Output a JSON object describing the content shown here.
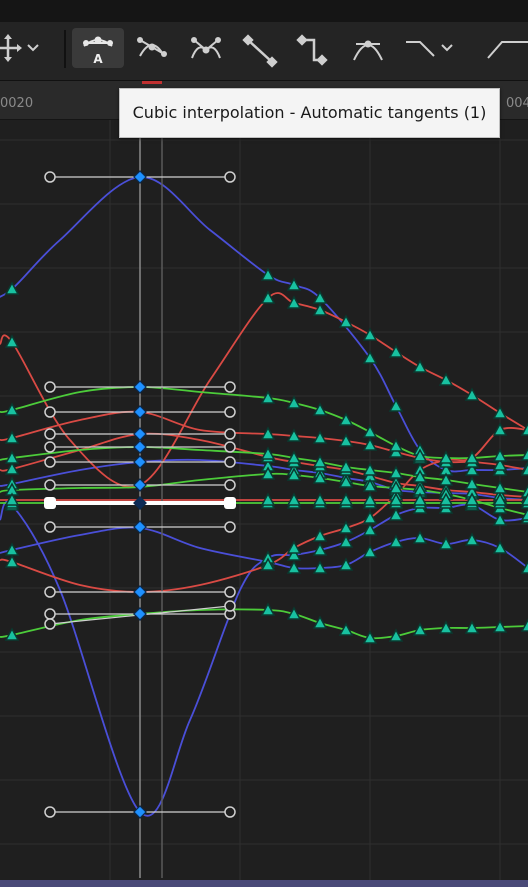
{
  "toolbar": {
    "buttons": [
      {
        "icon": "move-icon",
        "has_dropdown": true,
        "active": false
      },
      {
        "icon": "cubic-auto-tangent-icon",
        "badge": "A",
        "has_dropdown": false,
        "active": true
      },
      {
        "icon": "cubic-user-tangent-icon",
        "has_dropdown": false,
        "active": false
      },
      {
        "icon": "cubic-break-tangent-icon",
        "has_dropdown": false,
        "active": false
      },
      {
        "icon": "linear-interpolation-icon",
        "has_dropdown": false,
        "active": false
      },
      {
        "icon": "constant-interpolation-icon",
        "has_dropdown": false,
        "active": false
      },
      {
        "icon": "weighted-tangent-icon",
        "has_dropdown": false,
        "active": false
      },
      {
        "icon": "flatten-tangent-icon",
        "has_dropdown": true,
        "active": false
      },
      {
        "icon": "straighten-tangent-icon",
        "has_dropdown": false,
        "active": false
      }
    ]
  },
  "ruler": {
    "left_label": "0020",
    "right_label": "004"
  },
  "tooltip": {
    "text": "Cubic interpolation - Automatic tangents (1)"
  },
  "colors": {
    "background": "#1f1f1f",
    "grid": "#2f2f2f",
    "curve_blue": "#4a4fd8",
    "curve_red": "#d94a44",
    "curve_green": "#4ccc3a",
    "key_teal": "#18c1a0",
    "key_selected": "#1e90ff",
    "tangent_handle": "#d0d0d0",
    "playhead": "#c03030"
  }
}
